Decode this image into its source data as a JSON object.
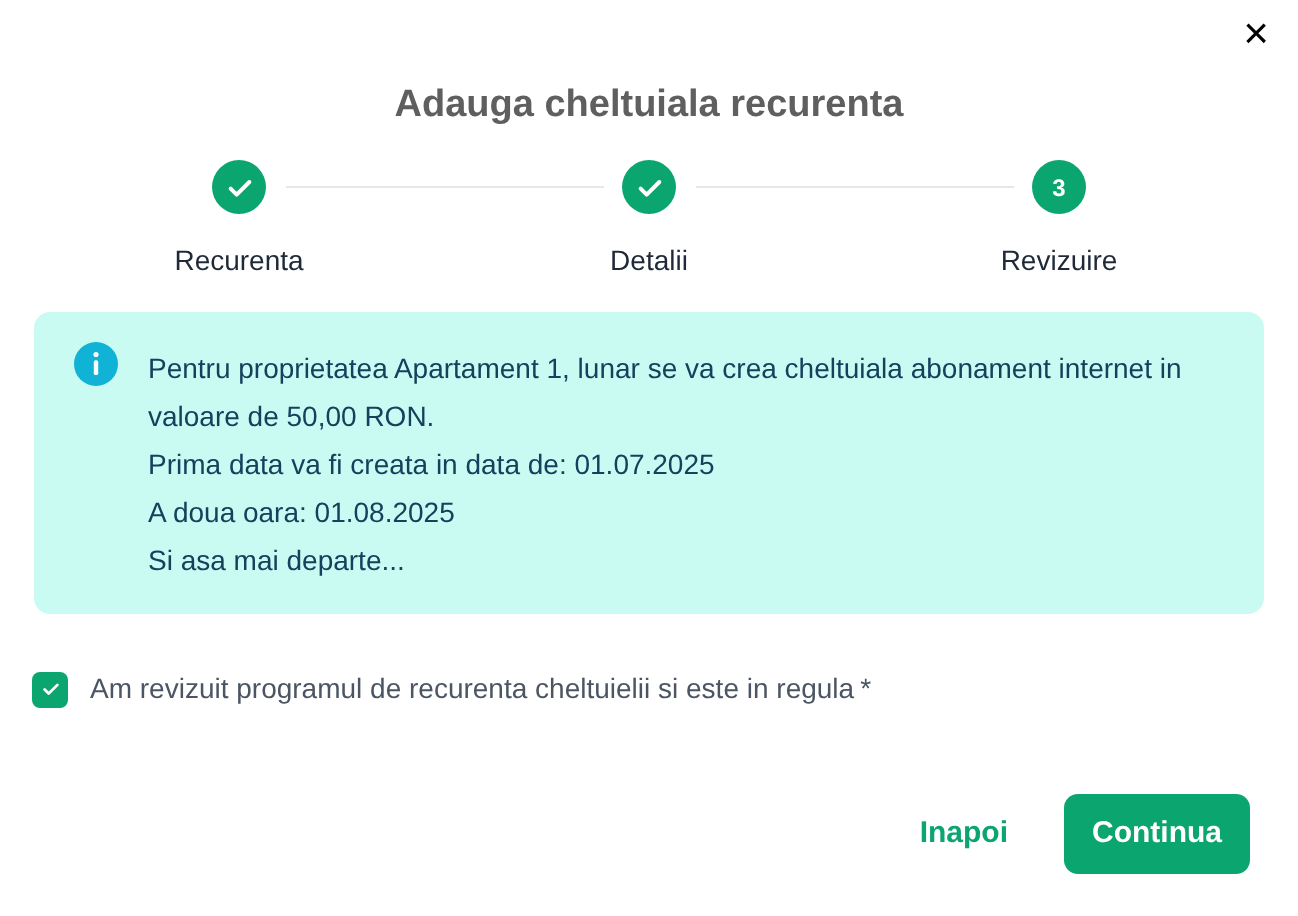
{
  "dialog": {
    "title": "Adauga cheltuiala recurenta",
    "close": "×"
  },
  "steps": [
    {
      "label": "Recurenta",
      "completed": true
    },
    {
      "label": "Detalii",
      "completed": true
    },
    {
      "label": "Revizuire",
      "completed": false,
      "number": "3"
    }
  ],
  "info": {
    "lines": [
      "Pentru proprietatea Apartament 1, lunar se va crea cheltuiala abonament internet in valoare de 50,00 RON.",
      "Prima data va fi creata in data de: 01.07.2025",
      "A doua oara: 01.08.2025",
      "Si asa mai departe..."
    ]
  },
  "confirm": {
    "label": "Am revizuit programul de recurenta cheltuielii si este in regula",
    "checked": true,
    "required_mark": "*"
  },
  "buttons": [
    {
      "label": "Inapoi",
      "kind": "text"
    },
    {
      "label": "Continua",
      "kind": "primary"
    }
  ]
}
